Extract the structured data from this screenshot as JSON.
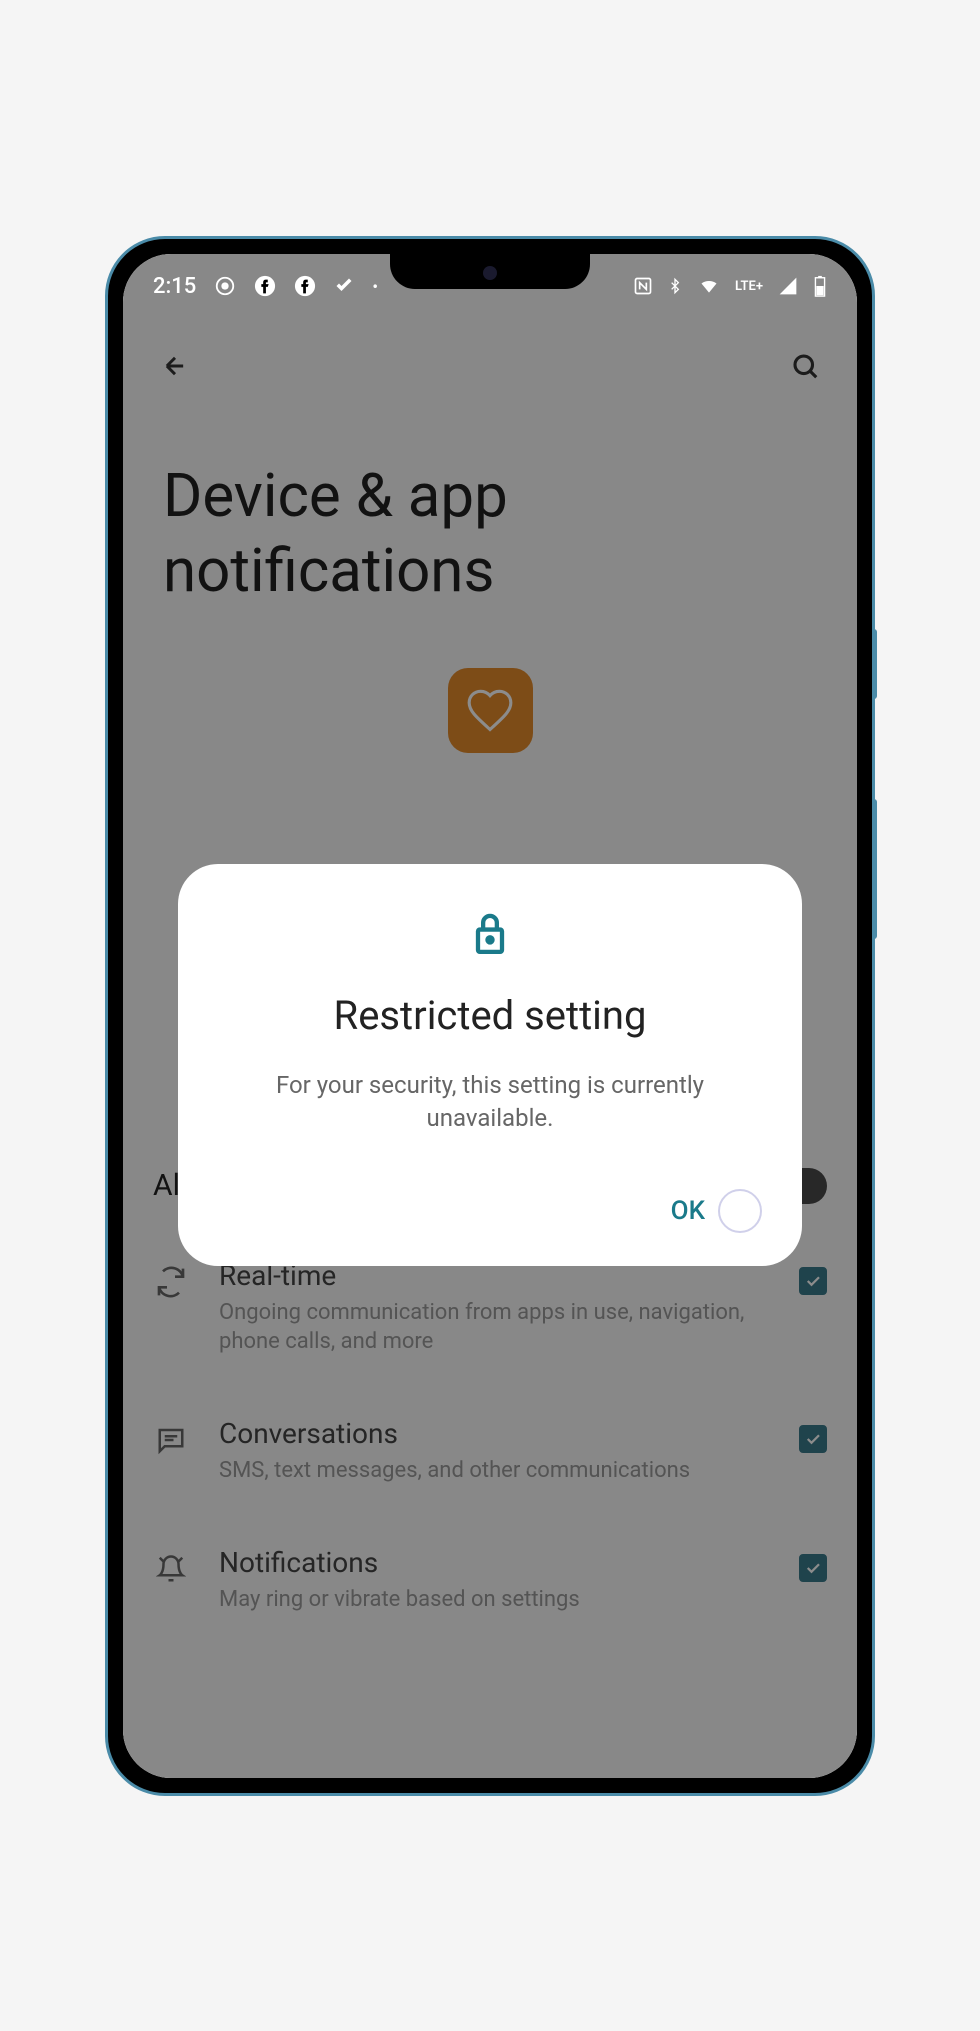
{
  "statusBar": {
    "time": "2:15",
    "lteLabel": "LTE+"
  },
  "page": {
    "title": "Device & app notifications"
  },
  "settings": {
    "allowToggle": {
      "label": "Allow notification access"
    },
    "items": [
      {
        "title": "Real-time",
        "subtitle": "Ongoing communication from apps in use, navigation, phone calls, and more"
      },
      {
        "title": "Conversations",
        "subtitle": "SMS, text messages, and other communications"
      },
      {
        "title": "Notifications",
        "subtitle": "May ring or vibrate based on settings"
      }
    ]
  },
  "dialog": {
    "title": "Restricted setting",
    "message": "For your security, this setting is currently unavailable.",
    "okLabel": "OK"
  }
}
